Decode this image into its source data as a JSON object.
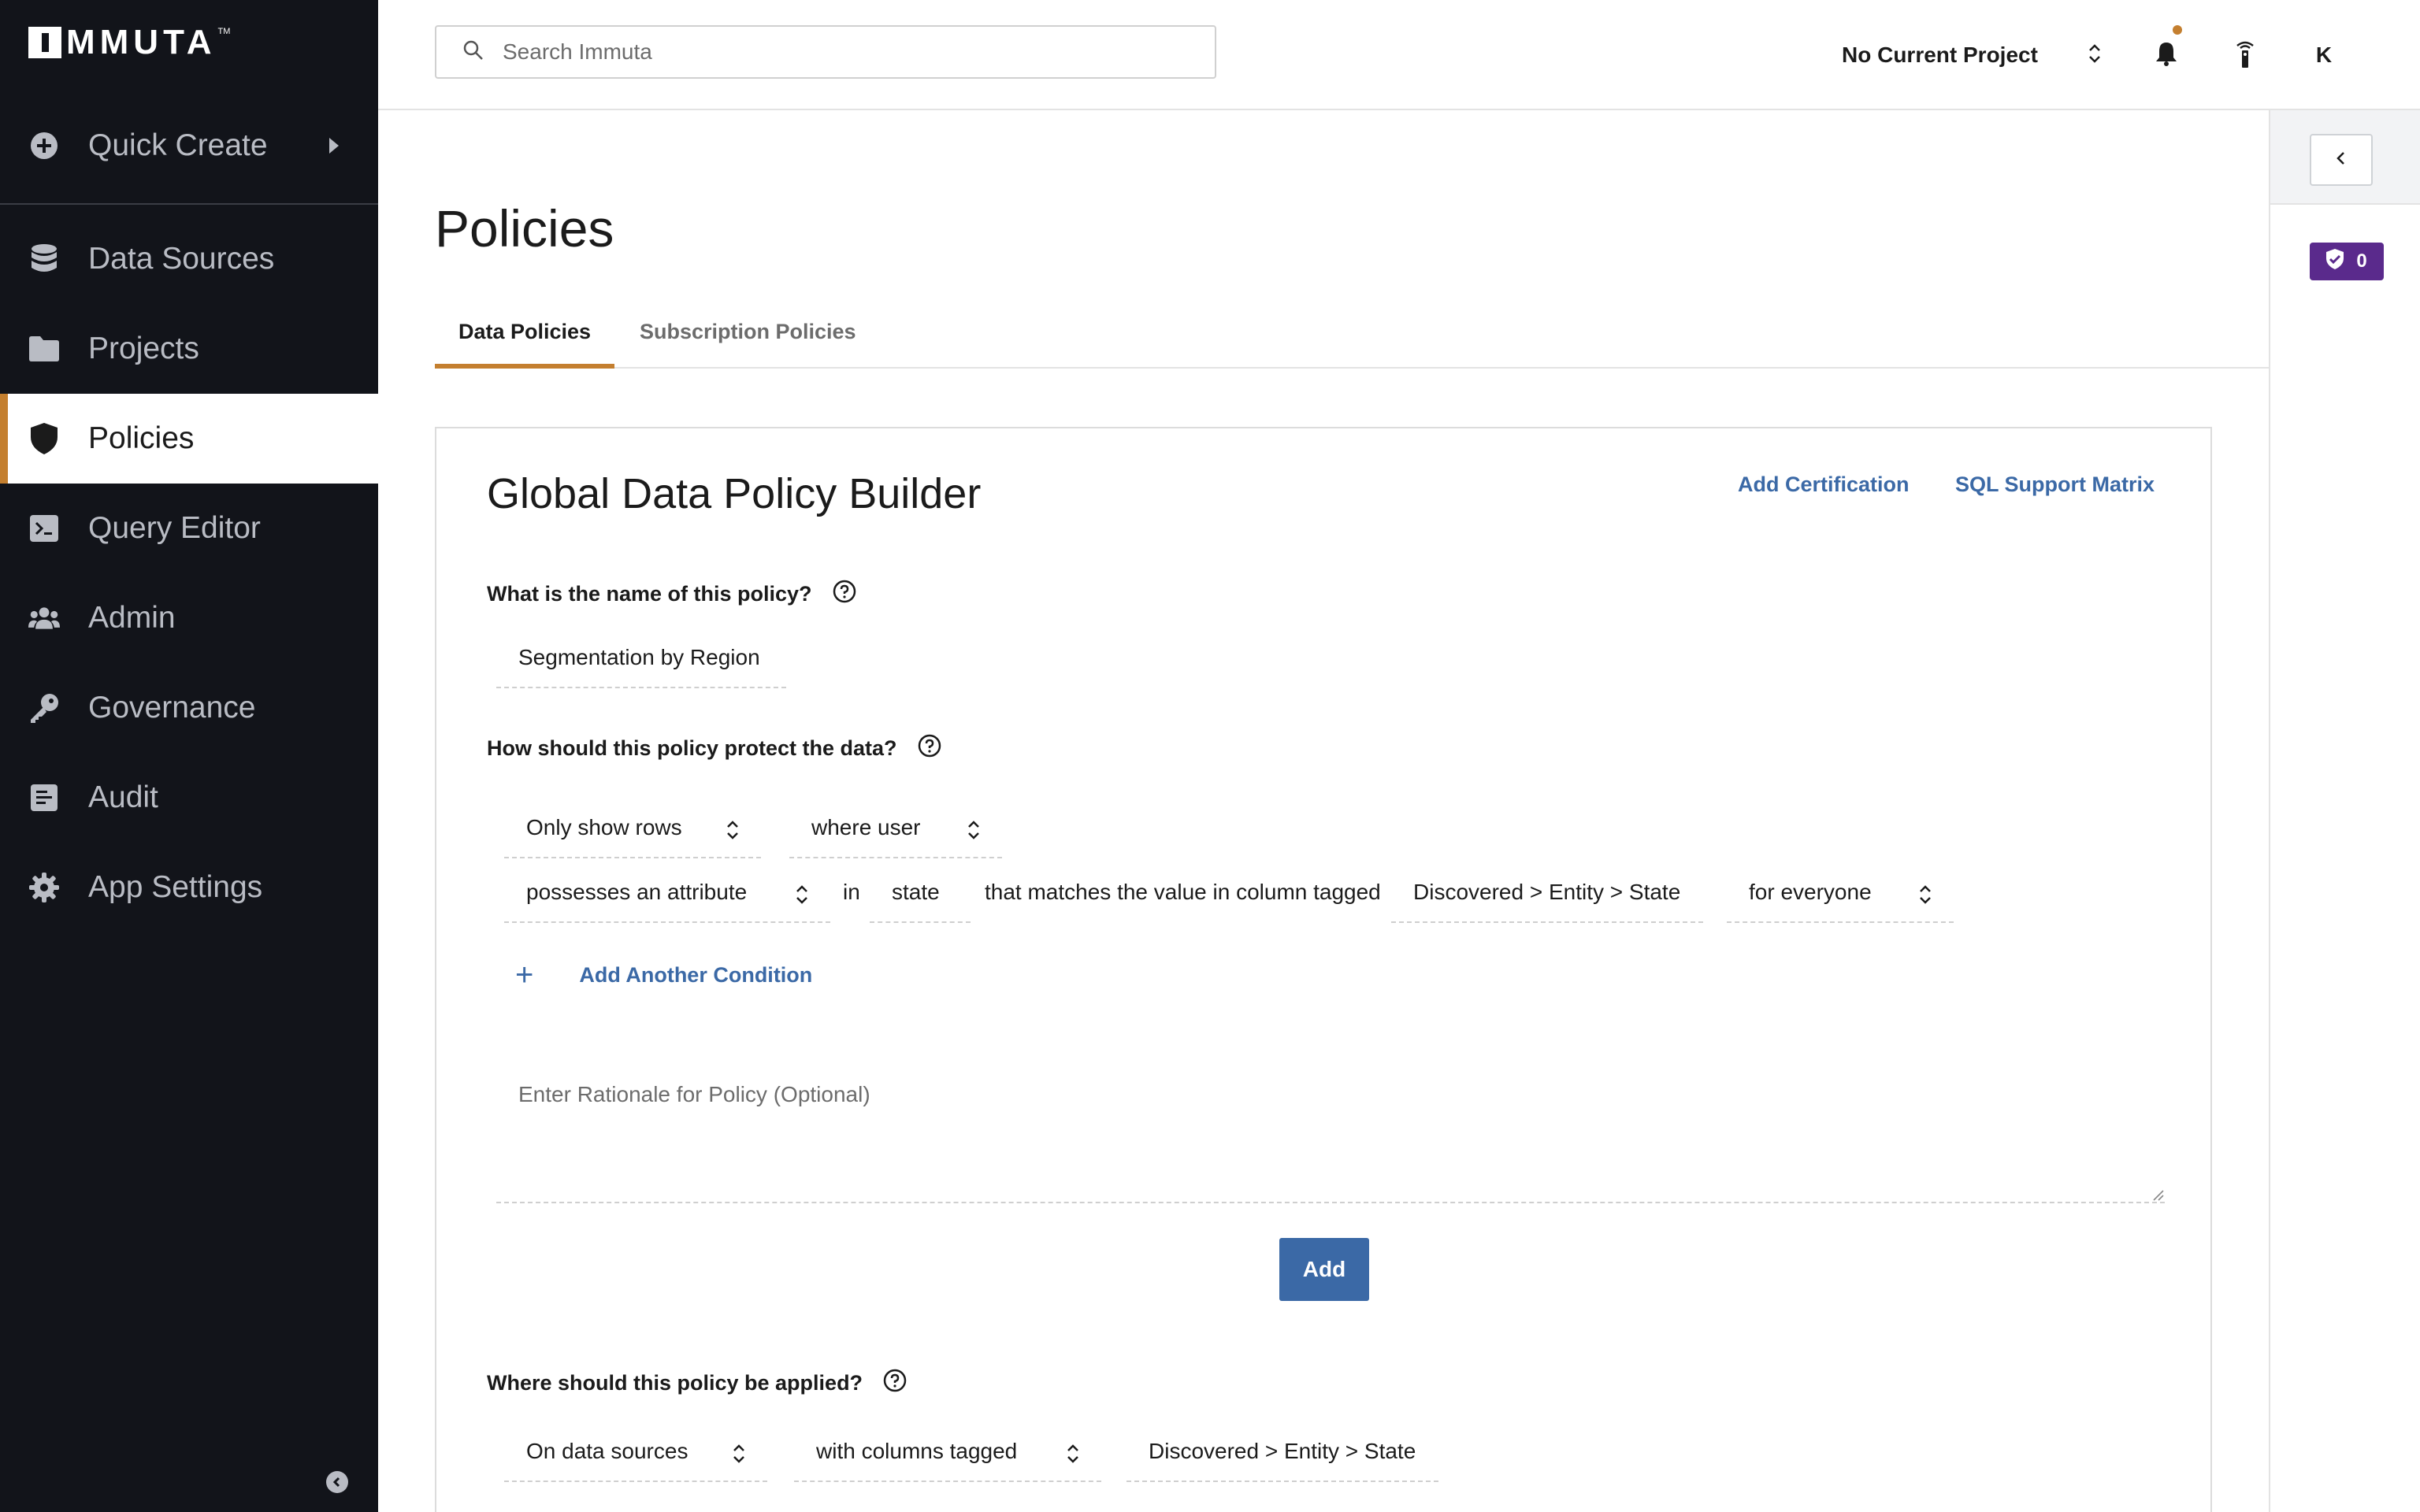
{
  "app": {
    "logo_text": "MMUTA",
    "logo_tm": "TM"
  },
  "sidebar": {
    "quick_create": "Quick Create",
    "items": [
      {
        "label": "Data Sources",
        "icon": "database-icon"
      },
      {
        "label": "Projects",
        "icon": "folder-icon"
      },
      {
        "label": "Policies",
        "icon": "shield-icon",
        "active": true
      },
      {
        "label": "Query Editor",
        "icon": "terminal-icon"
      },
      {
        "label": "Admin",
        "icon": "users-icon"
      },
      {
        "label": "Governance",
        "icon": "key-icon"
      },
      {
        "label": "Audit",
        "icon": "audit-icon"
      },
      {
        "label": "App Settings",
        "icon": "gear-icon"
      }
    ]
  },
  "header": {
    "search_placeholder": "Search Immuta",
    "project": "No Current Project",
    "avatar_initial": "K"
  },
  "right_panel": {
    "badge_count": "0"
  },
  "page": {
    "title": "Policies",
    "tabs": [
      {
        "label": "Data Policies",
        "active": true
      },
      {
        "label": "Subscription Policies",
        "active": false
      }
    ]
  },
  "builder": {
    "title": "Global Data Policy Builder",
    "add_certification": "Add Certification",
    "sql_support_matrix": "SQL Support Matrix",
    "q_name": "What is the name of this policy?",
    "policy_name": "Segmentation by Region",
    "q_protect": "How should this policy protect the data?",
    "rule_action": "Only show rows",
    "rule_where": "where user",
    "rule_condition": "possesses an attribute",
    "rule_in": "in",
    "rule_attribute": "state",
    "rule_matches": "that matches the value in column tagged",
    "rule_tag": "Discovered > Entity > State",
    "rule_scope": "for everyone",
    "add_another_condition": "Add Another Condition",
    "rationale_placeholder": "Enter Rationale for Policy (Optional)",
    "add_button": "Add",
    "q_applied": "Where should this policy be applied?",
    "applied_on": "On data sources",
    "applied_with": "with columns tagged",
    "applied_tag": "Discovered > Entity > State"
  },
  "colors": {
    "sidebar_bg": "#12141a",
    "accent": "#c47f2f",
    "link": "#3b69a6",
    "badge": "#5a2a8c"
  }
}
